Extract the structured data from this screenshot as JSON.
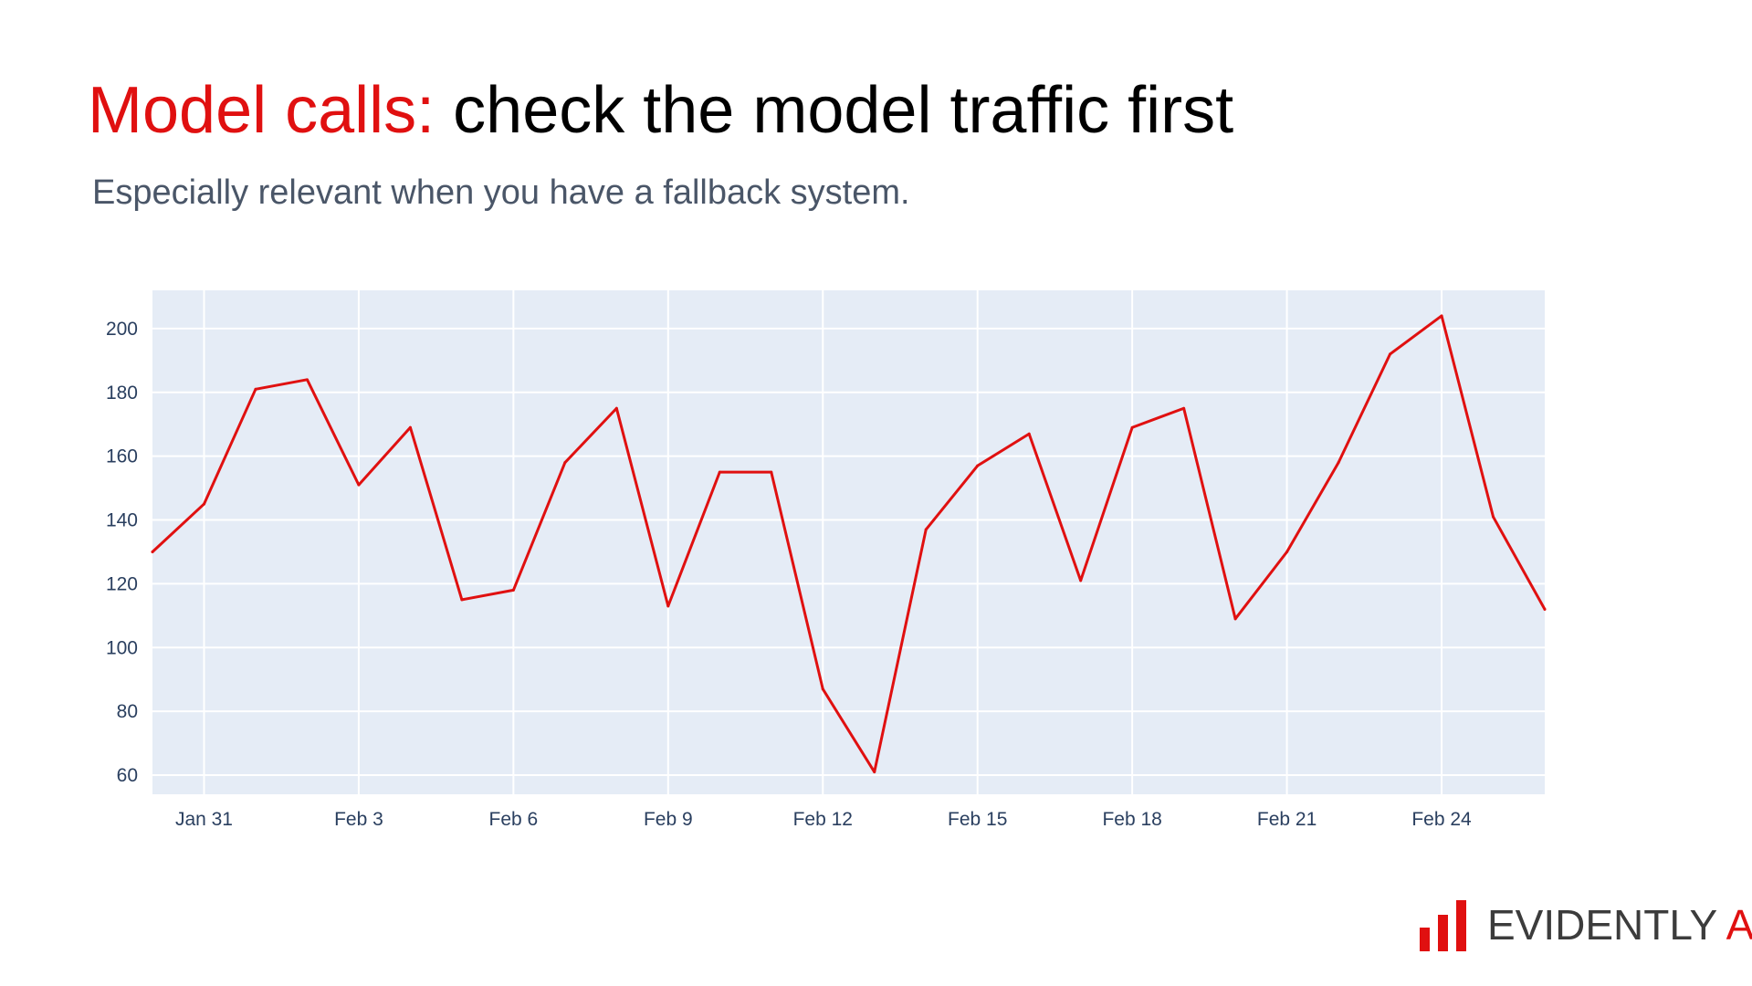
{
  "slide": {
    "title_accent": "Model calls:",
    "title_rest": " check the model traffic first",
    "subtitle": "Especially relevant when you have a fallback system."
  },
  "logo": {
    "text": "EVIDENTLY",
    "accent_text": "AI"
  },
  "colors": {
    "accent": "#e01010",
    "plot_background": "#e5ecf6",
    "grid": "#ffffff",
    "tick_text": "#2a3f5f",
    "logo_text": "#3c3c3c"
  },
  "chart_data": {
    "type": "line",
    "x_start": "Jan 30",
    "x": [
      "Jan 30",
      "Jan 31",
      "Feb 1",
      "Feb 2",
      "Feb 3",
      "Feb 4",
      "Feb 5",
      "Feb 6",
      "Feb 7",
      "Feb 8",
      "Feb 9",
      "Feb 10",
      "Feb 11",
      "Feb 12",
      "Feb 13",
      "Feb 14",
      "Feb 15",
      "Feb 16",
      "Feb 17",
      "Feb 18",
      "Feb 19",
      "Feb 20",
      "Feb 21",
      "Feb 22",
      "Feb 23",
      "Feb 24",
      "Feb 25",
      "Feb 26"
    ],
    "series": [
      {
        "color": "#e01010",
        "values": [
          130,
          145,
          181,
          184,
          151,
          169,
          115,
          118,
          158,
          175,
          113,
          155,
          155,
          87,
          61,
          137,
          157,
          167,
          121,
          169,
          175,
          109,
          130,
          158,
          192,
          204,
          141,
          112
        ]
      }
    ],
    "xticks": [
      "Jan 31",
      "Feb 3",
      "Feb 6",
      "Feb 9",
      "Feb 12",
      "Feb 15",
      "Feb 18",
      "Feb 21",
      "Feb 24"
    ],
    "xticks_index": [
      1,
      4,
      7,
      10,
      13,
      16,
      19,
      22,
      25
    ],
    "yticks": [
      60,
      80,
      100,
      120,
      140,
      160,
      180,
      200
    ],
    "ylim": [
      54,
      212
    ],
    "xlim": [
      0,
      27
    ],
    "grid": true,
    "legend": false,
    "title": "",
    "xlabel": "",
    "ylabel": ""
  }
}
